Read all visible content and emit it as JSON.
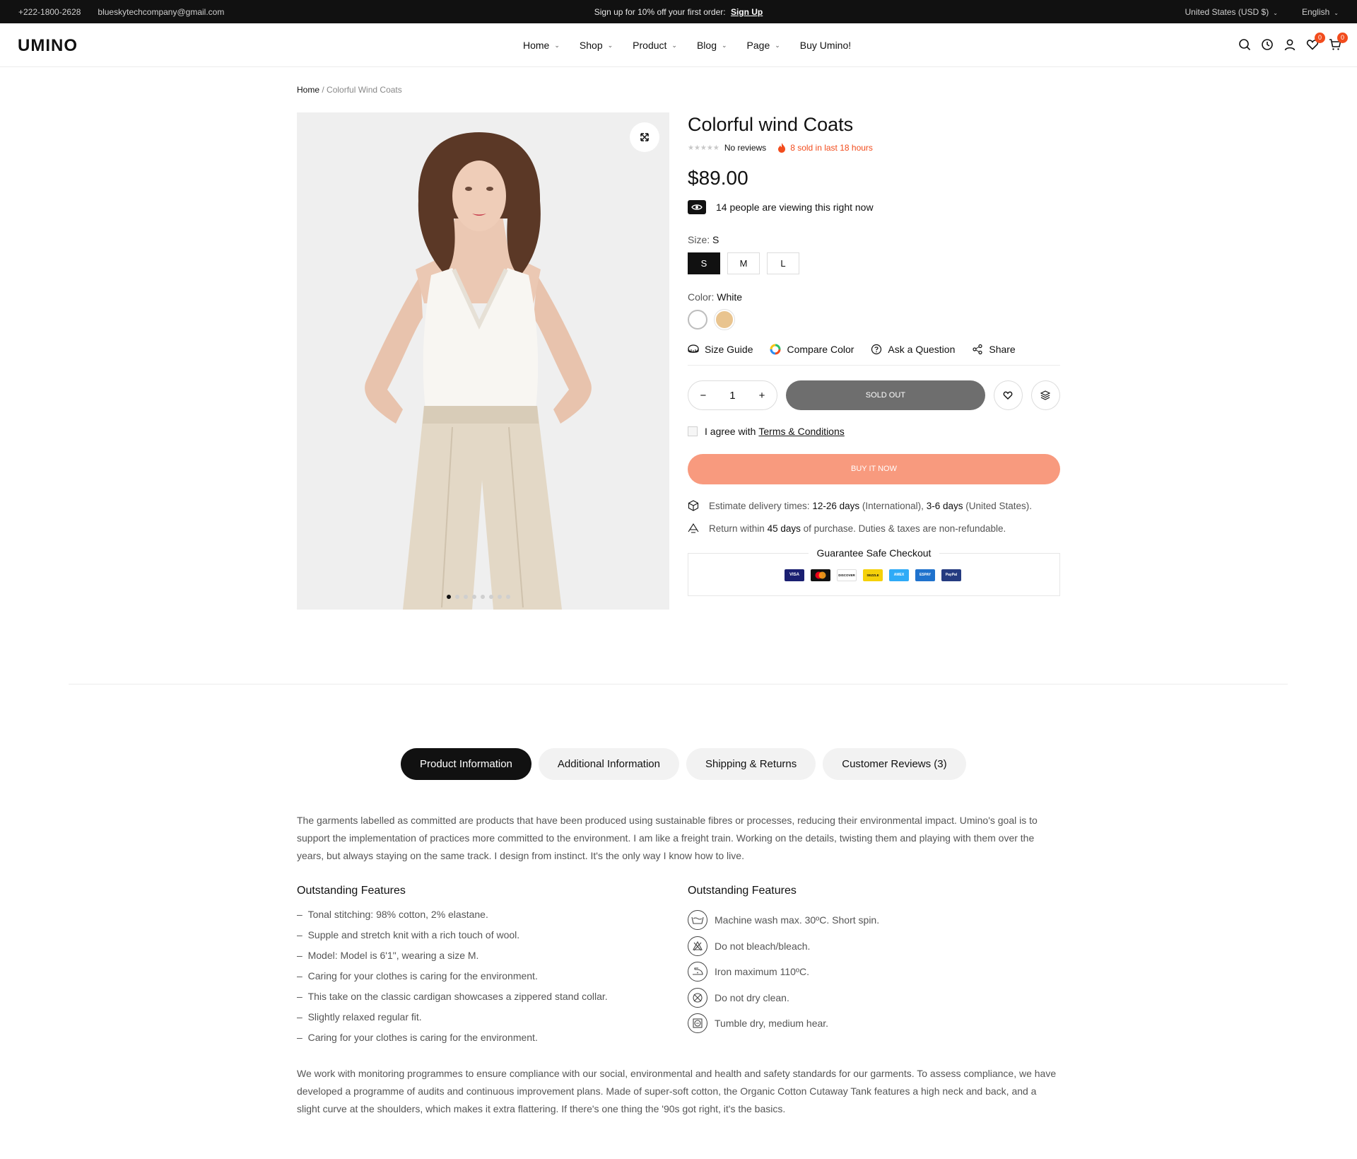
{
  "topbar": {
    "phone": "+222-1800-2628",
    "email": "blueskytechcompany@gmail.com",
    "promo": "Sign up for 10% off your first order:",
    "promo_link": "Sign Up",
    "currency": "United States (USD $)",
    "language": "English"
  },
  "header": {
    "logo": "UMINO",
    "nav": [
      "Home",
      "Shop",
      "Product",
      "Blog",
      "Page",
      "Buy Umino!"
    ],
    "wishlist_count": "0",
    "cart_count": "0"
  },
  "breadcrumb": {
    "home": "Home",
    "separator": "/",
    "current": "Colorful Wind Coats"
  },
  "gallery": {
    "slides": 8,
    "active": 1
  },
  "product": {
    "title": "Colorful wind Coats",
    "reviews": "No reviews",
    "sold": "8 sold in last 18 hours",
    "price": "$89.00",
    "viewing": "14 people are viewing this right now",
    "size_label": "Size:",
    "size_value": "S",
    "sizes": [
      "S",
      "M",
      "L"
    ],
    "color_label": "Color:",
    "color_value": "White",
    "colors": [
      "#ffffff",
      "#e9c48f"
    ],
    "links": [
      "Size Guide",
      "Compare Color",
      "Ask a Question",
      "Share"
    ],
    "quantity": "1",
    "sold_out": "SOLD OUT",
    "agree_text": "I agree with",
    "agree_link": "Terms & Conditions",
    "buy_now": "BUY IT NOW",
    "delivery": {
      "prefix": "Estimate delivery times:",
      "intl_days": "12-26 days",
      "intl_label": "(International),",
      "us_days": "3-6 days",
      "us_label": "(United States)."
    },
    "returns": {
      "prefix": "Return within",
      "days": "45 days",
      "suffix": "of purchase. Duties & taxes are non-refundable."
    },
    "guarantee": "Guarantee Safe Checkout",
    "payment_cards": [
      {
        "name": "VISA",
        "color": "#1a1f71"
      },
      {
        "name": "MC",
        "color": "#111111"
      },
      {
        "name": "DISCOVER",
        "color": "#ffffff"
      },
      {
        "name": "SEZZLE",
        "color": "#f5d10a"
      },
      {
        "name": "AMEX",
        "color": "#2fabf7"
      },
      {
        "name": "ESPAY",
        "color": "#1f72cd"
      },
      {
        "name": "PayPal",
        "color": "#253b80"
      }
    ]
  },
  "tabs": [
    "Product Information",
    "Additional Information",
    "Shipping & Returns",
    "Customer Reviews (3)"
  ],
  "description": {
    "intro": "The garments labelled as committed are products that have been produced using sustainable fibres or processes, reducing their environmental impact. Umino's goal is to support the implementation of practices more committed to the environment. I am like a freight train. Working on the details, twisting them and playing with them over the years, but always staying on the same track. I design from instinct. It's the only way I know how to live.",
    "features_left_title": "Outstanding Features",
    "features_left": [
      "Tonal stitching: 98% cotton, 2% elastane.",
      "Supple and stretch knit with a rich touch of wool.",
      "Model:  Model is 6'1\", wearing a size M.",
      "Caring for your clothes is caring for the environment.",
      "This take on the classic cardigan showcases a zippered stand collar.",
      "Slightly relaxed regular fit.",
      "Caring for your clothes is caring for the environment."
    ],
    "features_right_title": "Outstanding Features",
    "features_right": [
      "Machine wash max. 30ºC. Short spin.",
      "Do not bleach/bleach.",
      "Iron maximum 110ºC.",
      "Do not dry clean.",
      "Tumble dry, medium hear."
    ],
    "outro": "We work with monitoring programmes to ensure compliance with our social, environmental and health and safety standards for our garments. To assess compliance, we have developed a programme of audits and continuous improvement plans. Made of super-soft cotton, the Organic Cotton Cutaway Tank features a high neck and back, and a slight curve at the shoulders, which makes it extra flattering. If there's one thing the '90s got right, it's the basics."
  }
}
